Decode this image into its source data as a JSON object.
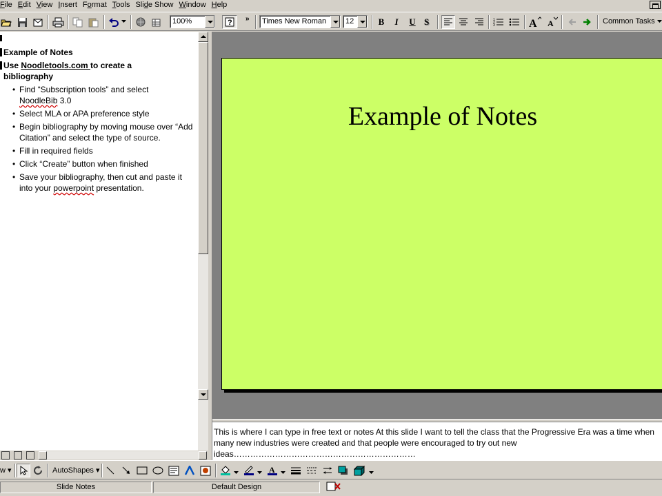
{
  "menu": {
    "items": [
      {
        "pre": "",
        "u": "F",
        "post": "ile"
      },
      {
        "pre": "",
        "u": "E",
        "post": "dit"
      },
      {
        "pre": "",
        "u": "V",
        "post": "iew"
      },
      {
        "pre": "",
        "u": "I",
        "post": "nsert"
      },
      {
        "pre": "F",
        "u": "o",
        "post": "rmat"
      },
      {
        "pre": "",
        "u": "T",
        "post": "ools"
      },
      {
        "pre": "Sli",
        "u": "d",
        "post": "e Show"
      },
      {
        "pre": "",
        "u": "W",
        "post": "indow"
      },
      {
        "pre": "",
        "u": "H",
        "post": "elp"
      }
    ]
  },
  "toolbar": {
    "zoom": "100%",
    "font_name": "Times New Roman",
    "font_size": "12",
    "bold": "B",
    "italic": "I",
    "underline": "U",
    "common_tasks": "Common Tasks"
  },
  "outline": {
    "slide1_title": "Example of Notes",
    "slide2_title_pre": "Use ",
    "slide2_title_link": "Noodletools.com ",
    "slide2_title_post": "to create a",
    "slide2_title_line2": "bibliography",
    "bullets": {
      "b1a": "Find “Subscription tools” and select",
      "b1b_sq": "NoodleBib",
      "b1b_rest": " 3.0",
      "b2": "Select MLA or APA preference style",
      "b3": "Begin bibliography by moving mouse over “Add Citation” and select the type of source.",
      "b4": "Fill in required fields",
      "b5": "Click “Create” button when finished",
      "b6_pre": "Save your bibliography, then cut and paste it into your ",
      "b6_sq": "powerpoint",
      "b6_post": " presentation."
    }
  },
  "slide": {
    "title": "Example of Notes"
  },
  "notes": {
    "text": "This is where I can type in free text or notes  At this slide I want to tell the class that the Progressive Era was a time when many new industries were created and that people were encouraged to try out new ideas…………………………………………………………"
  },
  "drawbar": {
    "autoshapes": "AutoShapes"
  },
  "status": {
    "slide": "Slide Notes",
    "design": "Default Design"
  },
  "icon_names": [
    "open-icon",
    "save-icon",
    "print-icon",
    "copy-icon",
    "paste-icon",
    "undo-icon",
    "hyperlink-icon",
    "help-icon",
    "align-left-icon",
    "align-center-icon",
    "align-right-icon",
    "numbering-icon",
    "bullets-icon",
    "increase-font-icon",
    "decrease-font-icon",
    "promote-icon",
    "demote-icon",
    "select-icon",
    "rotate-icon",
    "line-icon",
    "arrow-icon",
    "rectangle-icon",
    "oval-icon",
    "textbox-icon",
    "wordart-icon",
    "fill-color-icon",
    "line-color-icon",
    "font-color-icon",
    "line-style-icon",
    "dash-style-icon",
    "arrow-style-icon",
    "shadow-icon",
    "3d-icon"
  ]
}
